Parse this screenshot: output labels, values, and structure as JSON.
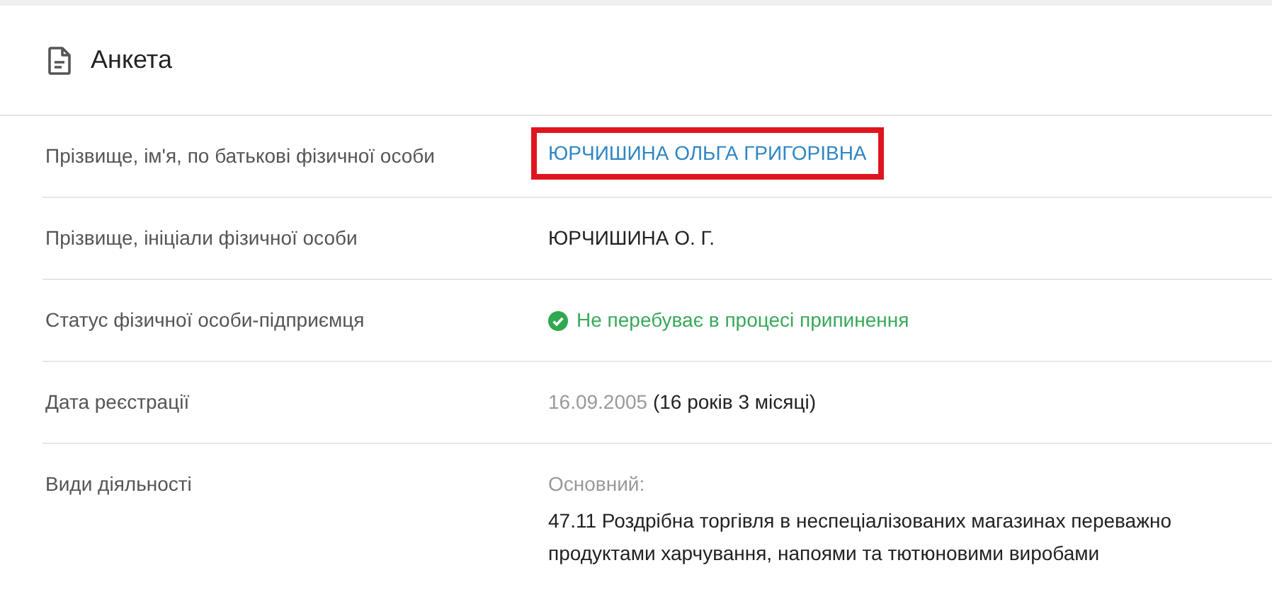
{
  "card": {
    "title": "Анкета"
  },
  "rows": [
    {
      "kind": "link",
      "label": "Прізвище, ім'я, по батькові фізичної особи",
      "value": "ЮРЧИШИНА ОЛЬГА ГРИГОРІВНА",
      "highlighted": true
    },
    {
      "kind": "text",
      "label": "Прізвище, ініціали фізичної особи",
      "value": "ЮРЧИШИНА О. Г."
    },
    {
      "kind": "status",
      "label": "Статус фізичної особи-підприємця",
      "value": "Не перебуває в процесі припинення"
    },
    {
      "kind": "date",
      "label": "Дата реєстрації",
      "date": "16.09.2005",
      "value": "(16 років 3 місяці)"
    },
    {
      "kind": "activity",
      "label": "Види діяльності",
      "caption": "Основний:",
      "value": "47.11 Роздрібна торгівля в неспеціалізованих магазинах переважно продуктами харчування, напоями та тютюновими виробами"
    }
  ]
}
